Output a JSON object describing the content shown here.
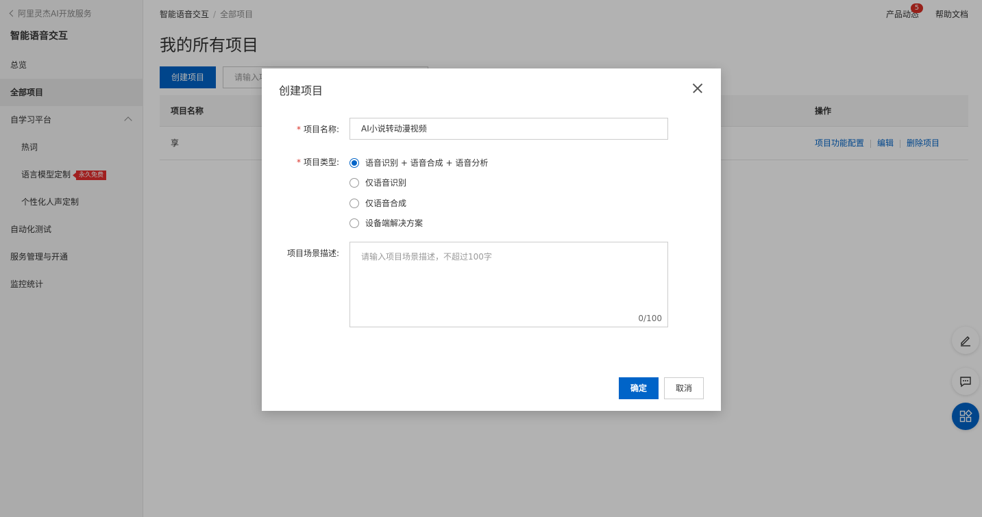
{
  "sidebar": {
    "back_label": "阿里灵杰AI开放服务",
    "title": "智能语音交互",
    "items": [
      {
        "label": "总览"
      },
      {
        "label": "全部项目"
      },
      {
        "label": "自学习平台"
      },
      {
        "label": "热词"
      },
      {
        "label": "语言模型定制",
        "badge": "永久免费"
      },
      {
        "label": "个性化人声定制"
      },
      {
        "label": "自动化测试"
      },
      {
        "label": "服务管理与开通"
      },
      {
        "label": "监控统计"
      }
    ]
  },
  "breadcrumb": {
    "parent": "智能语音交互",
    "separator": "/",
    "current": "全部项目"
  },
  "header": {
    "product_news": "产品动态",
    "news_count": "5",
    "help_docs": "帮助文档"
  },
  "page": {
    "title": "我的所有项目",
    "create_label": "创建项目",
    "search_placeholder": "请输入项"
  },
  "table": {
    "col_name": "项目名称",
    "col_actions": "操作",
    "rows": [
      {
        "name": "享",
        "action_config": "项目功能配置",
        "action_edit": "编辑",
        "action_delete": "删除项目"
      }
    ]
  },
  "modal": {
    "title": "创建项目",
    "name_label": "项目名称:",
    "name_value": "AI小说转动漫视频",
    "type_label": "项目类型:",
    "type_options": [
      "语音识别 + 语音合成 + 语音分析",
      "仅语音识别",
      "仅语音合成",
      "设备端解决方案"
    ],
    "type_selected": 0,
    "desc_label": "项目场景描述:",
    "desc_placeholder": "请输入项目场景描述，不超过100字",
    "desc_counter": "0/100",
    "ok_label": "确定",
    "cancel_label": "取消"
  },
  "colors": {
    "primary": "#0064c8",
    "danger": "#d93026"
  }
}
